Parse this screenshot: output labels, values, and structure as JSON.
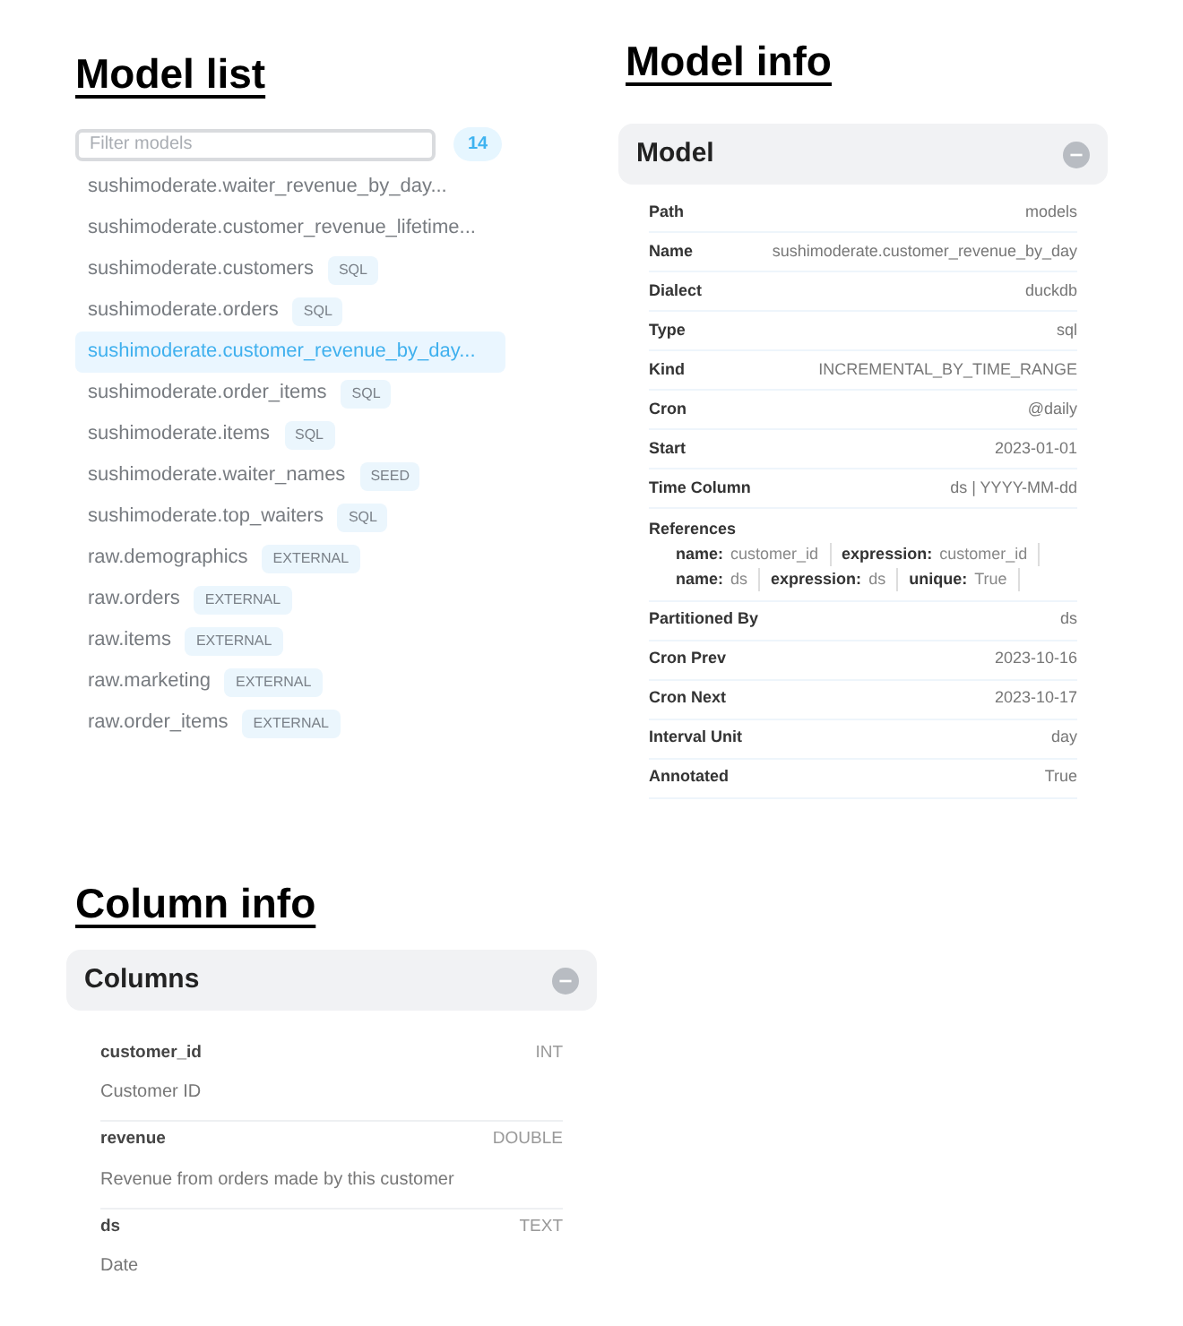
{
  "model_list": {
    "heading": "Model list",
    "filter_placeholder": "Filter models",
    "count": "14",
    "items": [
      {
        "name": "sushimoderate.waiter_revenue_by_day...",
        "selected": false
      },
      {
        "name": "sushimoderate.customer_revenue_lifetime...",
        "selected": false
      },
      {
        "name": "sushimoderate.customers",
        "tag": "SQL",
        "selected": false
      },
      {
        "name": "sushimoderate.orders",
        "tag": "SQL",
        "selected": false
      },
      {
        "name": "sushimoderate.customer_revenue_by_day...",
        "selected": true
      },
      {
        "name": "sushimoderate.order_items",
        "tag": "SQL",
        "selected": false
      },
      {
        "name": "sushimoderate.items",
        "tag": "SQL",
        "selected": false
      },
      {
        "name": "sushimoderate.waiter_names",
        "tag": "SEED",
        "selected": false
      },
      {
        "name": "sushimoderate.top_waiters",
        "tag": "SQL",
        "selected": false
      },
      {
        "name": "raw.demographics",
        "tag": "EXTERNAL",
        "selected": false
      },
      {
        "name": "raw.orders",
        "tag": "EXTERNAL",
        "selected": false
      },
      {
        "name": "raw.items",
        "tag": "EXTERNAL",
        "selected": false
      },
      {
        "name": "raw.marketing",
        "tag": "EXTERNAL",
        "selected": false
      },
      {
        "name": "raw.order_items",
        "tag": "EXTERNAL",
        "selected": false
      }
    ]
  },
  "model_info": {
    "heading": "Model info",
    "title": "Model",
    "fields": [
      {
        "kind": "pair",
        "label": "Path",
        "value": "models"
      },
      {
        "kind": "pair",
        "label": "Name",
        "value": "sushimoderate.customer_revenue_by_day"
      },
      {
        "kind": "pair",
        "label": "Dialect",
        "value": "duckdb"
      },
      {
        "kind": "pair",
        "label": "Type",
        "value": "sql"
      },
      {
        "kind": "pair",
        "label": "Kind",
        "value": "INCREMENTAL_BY_TIME_RANGE"
      },
      {
        "kind": "pair",
        "label": "Cron",
        "value": "@daily"
      },
      {
        "kind": "pair",
        "label": "Start",
        "value": "2023-01-01"
      },
      {
        "kind": "pair",
        "label": "Time Column",
        "value": "ds | YYYY-MM-dd"
      },
      {
        "kind": "references",
        "label": "References",
        "rows": [
          [
            {
              "key": "name:",
              "value": "customer_id"
            },
            {
              "key": "expression:",
              "value": "customer_id"
            }
          ],
          [
            {
              "key": "name:",
              "value": "ds"
            },
            {
              "key": "expression:",
              "value": "ds"
            },
            {
              "key": "unique:",
              "value": "True"
            }
          ]
        ]
      },
      {
        "kind": "pair",
        "label": "Partitioned By",
        "value": "ds"
      },
      {
        "kind": "pair",
        "label": "Cron Prev",
        "value": "2023-10-16"
      },
      {
        "kind": "pair",
        "label": "Cron Next",
        "value": "2023-10-17"
      },
      {
        "kind": "pair",
        "label": "Interval Unit",
        "value": "day"
      },
      {
        "kind": "pair",
        "label": "Annotated",
        "value": "True"
      }
    ]
  },
  "column_info": {
    "heading": "Column info",
    "title": "Columns",
    "columns": [
      {
        "name": "customer_id",
        "type": "INT",
        "description": "Customer ID"
      },
      {
        "name": "revenue",
        "type": "DOUBLE",
        "description": "Revenue from orders made by this customer"
      },
      {
        "name": "ds",
        "type": "TEXT",
        "description": "Date"
      }
    ]
  }
}
